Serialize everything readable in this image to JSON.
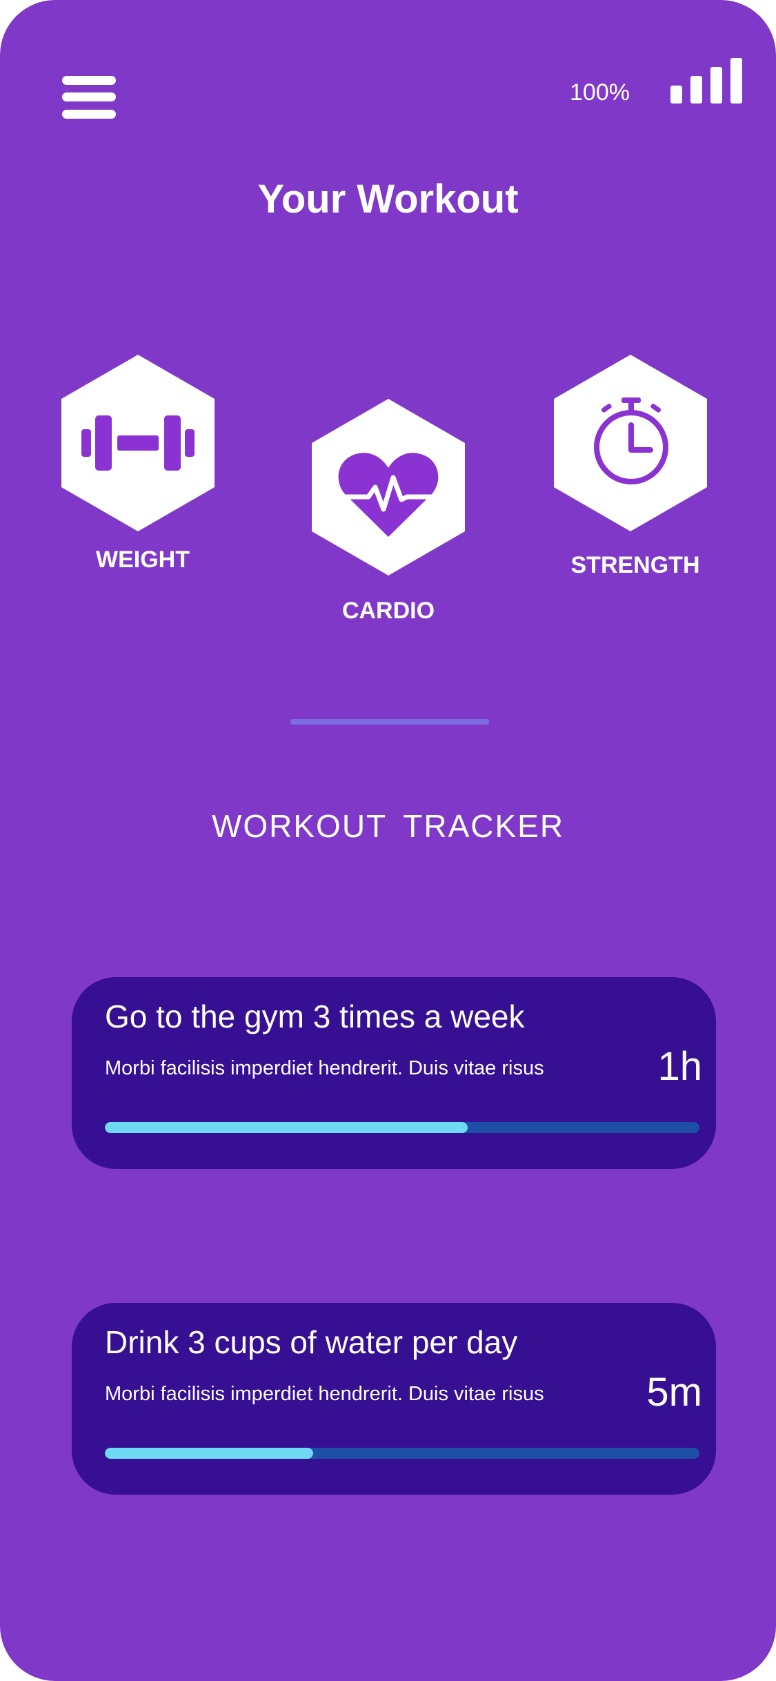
{
  "status_bar": {
    "battery": "100%",
    "menu_icon": "hamburger-menu-icon",
    "signal_icon": "signal-bars-icon"
  },
  "header": {
    "title": "Your Workout"
  },
  "categories": [
    {
      "label": "WEIGHT",
      "icon": "dumbbell-icon"
    },
    {
      "label": "CARDIO",
      "icon": "heart-pulse-icon"
    },
    {
      "label": "STRENGTH",
      "icon": "stopwatch-icon"
    }
  ],
  "tracker": {
    "title": "WORKOUT  TRACKER",
    "items": [
      {
        "title": "Go to the gym 3 times a week",
        "description": "Morbi facilisis imperdiet hendrerit. Duis vitae risus",
        "time": "1h",
        "progress": 0.61
      },
      {
        "title": "Drink 3 cups of water per day",
        "description": "Morbi facilisis imperdiet hendrerit. Duis vitae risus",
        "time": "5m",
        "progress": 0.35
      }
    ]
  },
  "colors": {
    "background": "#8038c8",
    "card": "#360f92",
    "accent_icon": "#8a32d2",
    "progress_fill": "#6fd8f2",
    "progress_track": "#1e4fa6",
    "divider": "#7b6de0"
  }
}
